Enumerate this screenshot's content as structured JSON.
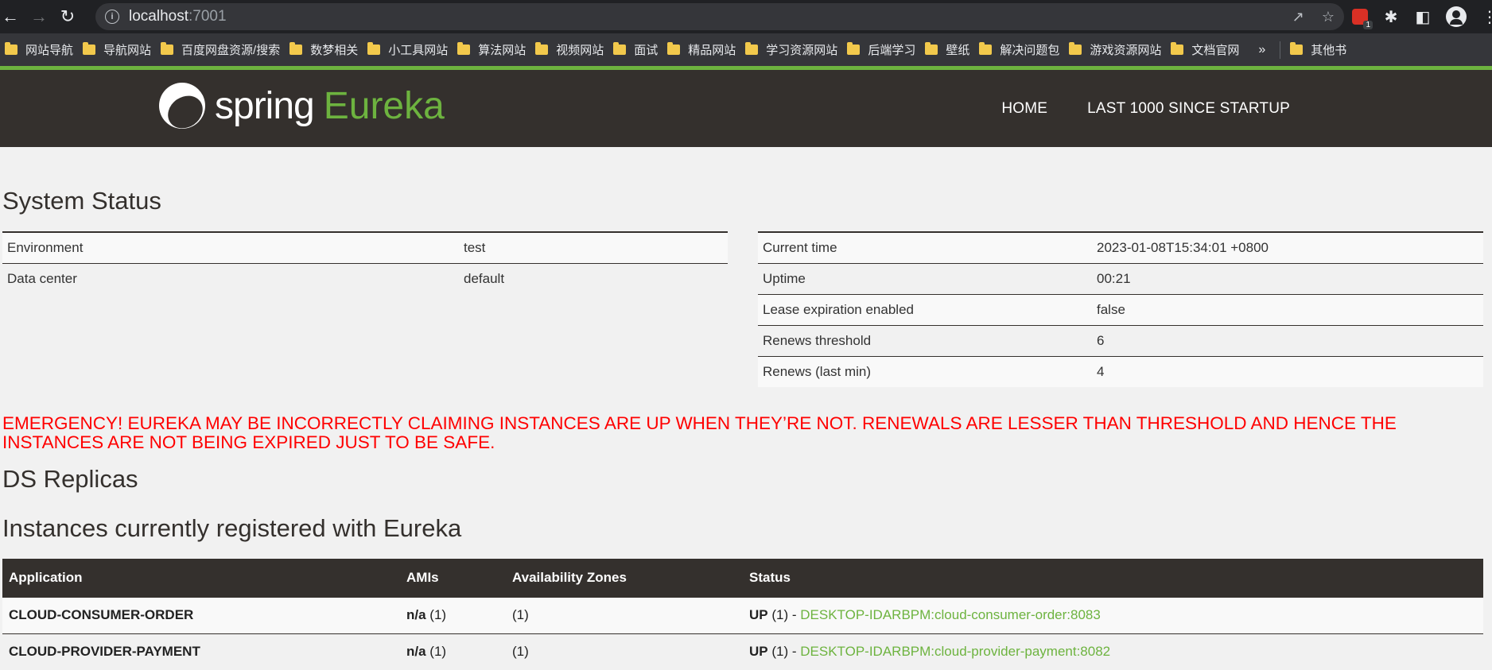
{
  "browser": {
    "url_host": "localhost",
    "url_port": ":7001",
    "bookmarks": [
      "网站导航",
      "导航网站",
      "百度网盘资源/搜索",
      "数梦相关",
      "小工具网站",
      "算法网站",
      "视频网站",
      "面试",
      "精品网站",
      "学习资源网站",
      "后端学习",
      "壁纸",
      "解决问题包",
      "游戏资源网站",
      "文档官网"
    ],
    "bookmarks_more": "»",
    "other_bookmarks": "其他书",
    "extension_badge": "1"
  },
  "header": {
    "logo_spring": "spring",
    "logo_eureka": "Eureka",
    "nav": [
      "HOME",
      "LAST 1000 SINCE STARTUP"
    ]
  },
  "system_status": {
    "title": "System Status",
    "left": [
      {
        "key": "Environment",
        "value": "test"
      },
      {
        "key": "Data center",
        "value": "default"
      }
    ],
    "right": [
      {
        "key": "Current time",
        "value": "2023-01-08T15:34:01 +0800"
      },
      {
        "key": "Uptime",
        "value": "00:21"
      },
      {
        "key": "Lease expiration enabled",
        "value": "false"
      },
      {
        "key": "Renews threshold",
        "value": "6"
      },
      {
        "key": "Renews (last min)",
        "value": "4"
      }
    ]
  },
  "emergency": "EMERGENCY! EUREKA MAY BE INCORRECTLY CLAIMING INSTANCES ARE UP WHEN THEY’RE NOT. RENEWALS ARE LESSER THAN THRESHOLD AND HENCE THE INSTANCES ARE NOT BEING EXPIRED JUST TO BE SAFE.",
  "ds_replicas_title": "DS Replicas",
  "instances": {
    "title": "Instances currently registered with Eureka",
    "headers": [
      "Application",
      "AMIs",
      "Availability Zones",
      "Status"
    ],
    "rows": [
      {
        "app": "CLOUD-CONSUMER-ORDER",
        "ami_bold": "n/a",
        "ami_count": " (1)",
        "az": "(1)",
        "status_bold": "UP",
        "status_count": " (1) - ",
        "link": "DESKTOP-IDARBPM:cloud-consumer-order:8083"
      },
      {
        "app": "CLOUD-PROVIDER-PAYMENT",
        "ami_bold": "n/a",
        "ami_count": " (1)",
        "az": "(1)",
        "status_bold": "UP",
        "status_count": " (1) - ",
        "link": "DESKTOP-IDARBPM:cloud-provider-payment:8082"
      }
    ]
  },
  "colors": {
    "spring_green": "#6db33f",
    "header_dark": "#34302d",
    "emergency_red": "#ff0000"
  }
}
